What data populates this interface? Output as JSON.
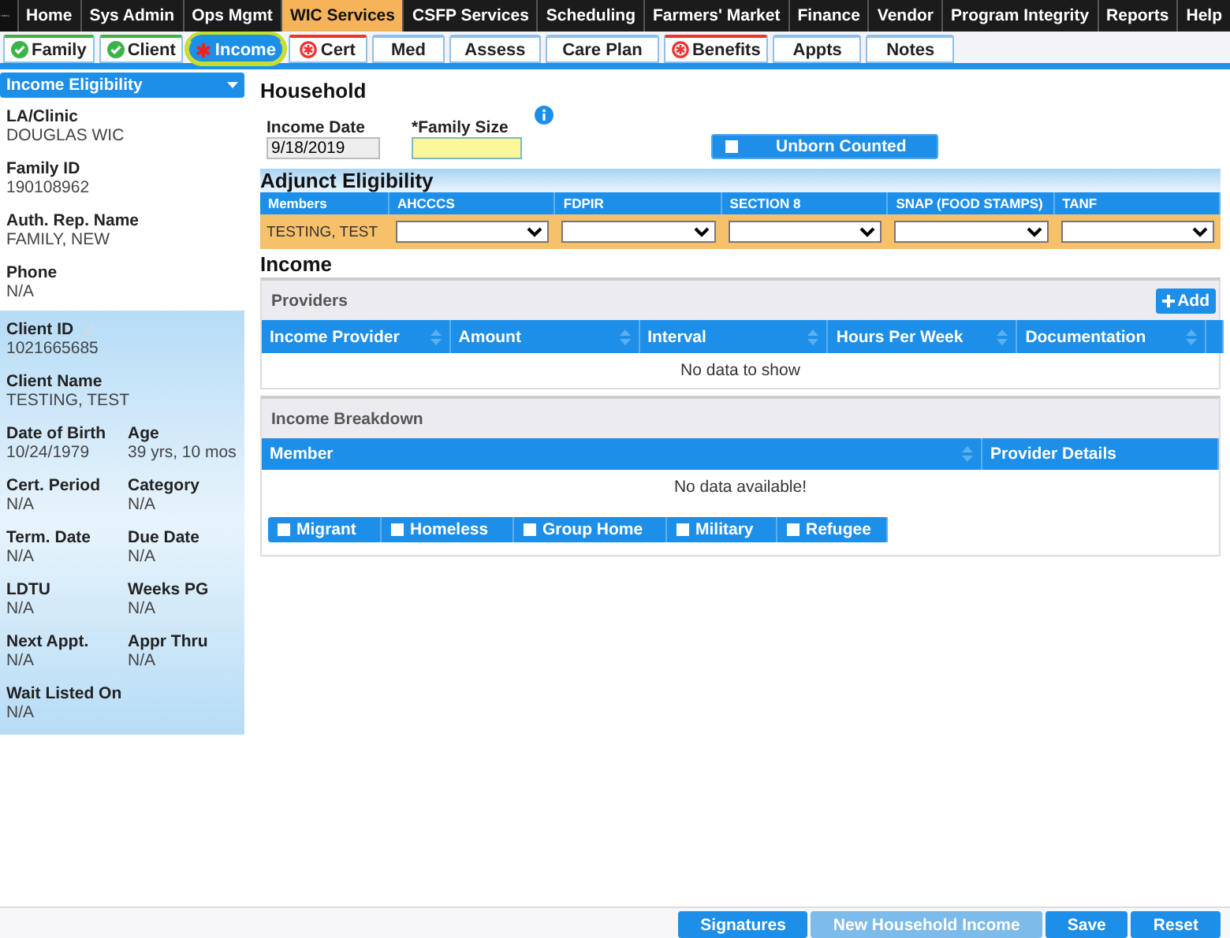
{
  "nav": [
    {
      "label": "Home",
      "selected": false
    },
    {
      "label": "Sys Admin",
      "selected": false
    },
    {
      "label": "Ops Mgmt",
      "selected": false
    },
    {
      "label": "WIC Services",
      "selected": true
    },
    {
      "label": "CSFP Services",
      "selected": false
    },
    {
      "label": "Scheduling",
      "selected": false
    },
    {
      "label": "Farmers' Market",
      "selected": false
    },
    {
      "label": "Finance",
      "selected": false
    },
    {
      "label": "Vendor",
      "selected": false
    },
    {
      "label": "Program Integrity",
      "selected": false
    },
    {
      "label": "Reports",
      "selected": false
    },
    {
      "label": "Help",
      "selected": false
    }
  ],
  "tabs": [
    {
      "label": "Family",
      "kind": "complete",
      "selected": false
    },
    {
      "label": "Client",
      "kind": "complete",
      "selected": false
    },
    {
      "label": "Income",
      "kind": "asterisk",
      "selected": true
    },
    {
      "label": "Cert",
      "kind": "required",
      "selected": false
    },
    {
      "label": "Med",
      "kind": "plain",
      "selected": false
    },
    {
      "label": "Assess",
      "kind": "plain",
      "selected": false
    },
    {
      "label": "Care Plan",
      "kind": "plain",
      "selected": false
    },
    {
      "label": "Benefits",
      "kind": "required",
      "selected": false
    },
    {
      "label": "Appts",
      "kind": "plain",
      "selected": false
    },
    {
      "label": "Notes",
      "kind": "plain",
      "selected": false
    }
  ],
  "sidebar": {
    "menu": "Income Eligibility",
    "family_fields": [
      {
        "label": "LA/Clinic",
        "value": "DOUGLAS WIC"
      },
      {
        "label": "Family ID",
        "value": "190108962"
      },
      {
        "label": "Auth. Rep. Name",
        "value": "FAMILY, NEW"
      },
      {
        "label": "Phone",
        "value": "N/A"
      }
    ],
    "client_id": {
      "label": "Client ID",
      "value": "1021665685"
    },
    "client_fields": [
      {
        "label": "Client Name",
        "value": "TESTING, TEST",
        "wide": true
      },
      {
        "label": "Date of Birth",
        "value": "10/24/1979",
        "wide": false
      },
      {
        "label": "Age",
        "value": "39 yrs, 10 mos",
        "wide": false
      },
      {
        "label": "Cert. Period",
        "value": "N/A",
        "wide": false
      },
      {
        "label": "Category",
        "value": "N/A",
        "wide": false
      },
      {
        "label": "Term. Date",
        "value": "N/A",
        "wide": false
      },
      {
        "label": "Due Date",
        "value": "N/A",
        "wide": false
      },
      {
        "label": "LDTU",
        "value": "N/A",
        "wide": false
      },
      {
        "label": "Weeks PG",
        "value": "N/A",
        "wide": false
      },
      {
        "label": "Next Appt.",
        "value": "N/A",
        "wide": false
      },
      {
        "label": "Appr Thru",
        "value": "N/A",
        "wide": false
      },
      {
        "label": "Wait Listed On",
        "value": "N/A",
        "wide": true
      }
    ]
  },
  "household": {
    "title": "Household",
    "income_date": {
      "label": "Income Date",
      "value": "9/18/2019"
    },
    "family_size": {
      "label": "*Family Size"
    },
    "unborn_counted": {
      "label": "Unborn Counted",
      "checked": false
    }
  },
  "adjunct": {
    "title": "Adjunct Eligibility",
    "columns": [
      "Members",
      "AHCCCS",
      "FDPIR",
      "SECTION 8",
      "SNAP (FOOD STAMPS)",
      "TANF"
    ],
    "rows": [
      {
        "member": "TESTING, TEST"
      }
    ]
  },
  "income": {
    "title": "Income",
    "providers": {
      "title": "Providers",
      "add": "Add",
      "columns": [
        "Income Provider",
        "Amount",
        "Interval",
        "Hours Per Week",
        "Documentation"
      ],
      "empty": "No data to show"
    },
    "breakdown": {
      "title": "Income Breakdown",
      "columns": [
        "Member",
        "Provider Details"
      ],
      "empty": "No data available!"
    },
    "flags": [
      {
        "label": "Migrant",
        "checked": false
      },
      {
        "label": "Homeless",
        "checked": false
      },
      {
        "label": "Group Home",
        "checked": false
      },
      {
        "label": "Military",
        "checked": false
      },
      {
        "label": "Refugee",
        "checked": false
      }
    ]
  },
  "footer": [
    {
      "label": "Signatures",
      "disabled": false
    },
    {
      "label": "New Household Income",
      "disabled": true
    },
    {
      "label": "Save",
      "disabled": false
    },
    {
      "label": "Reset",
      "disabled": false
    }
  ]
}
